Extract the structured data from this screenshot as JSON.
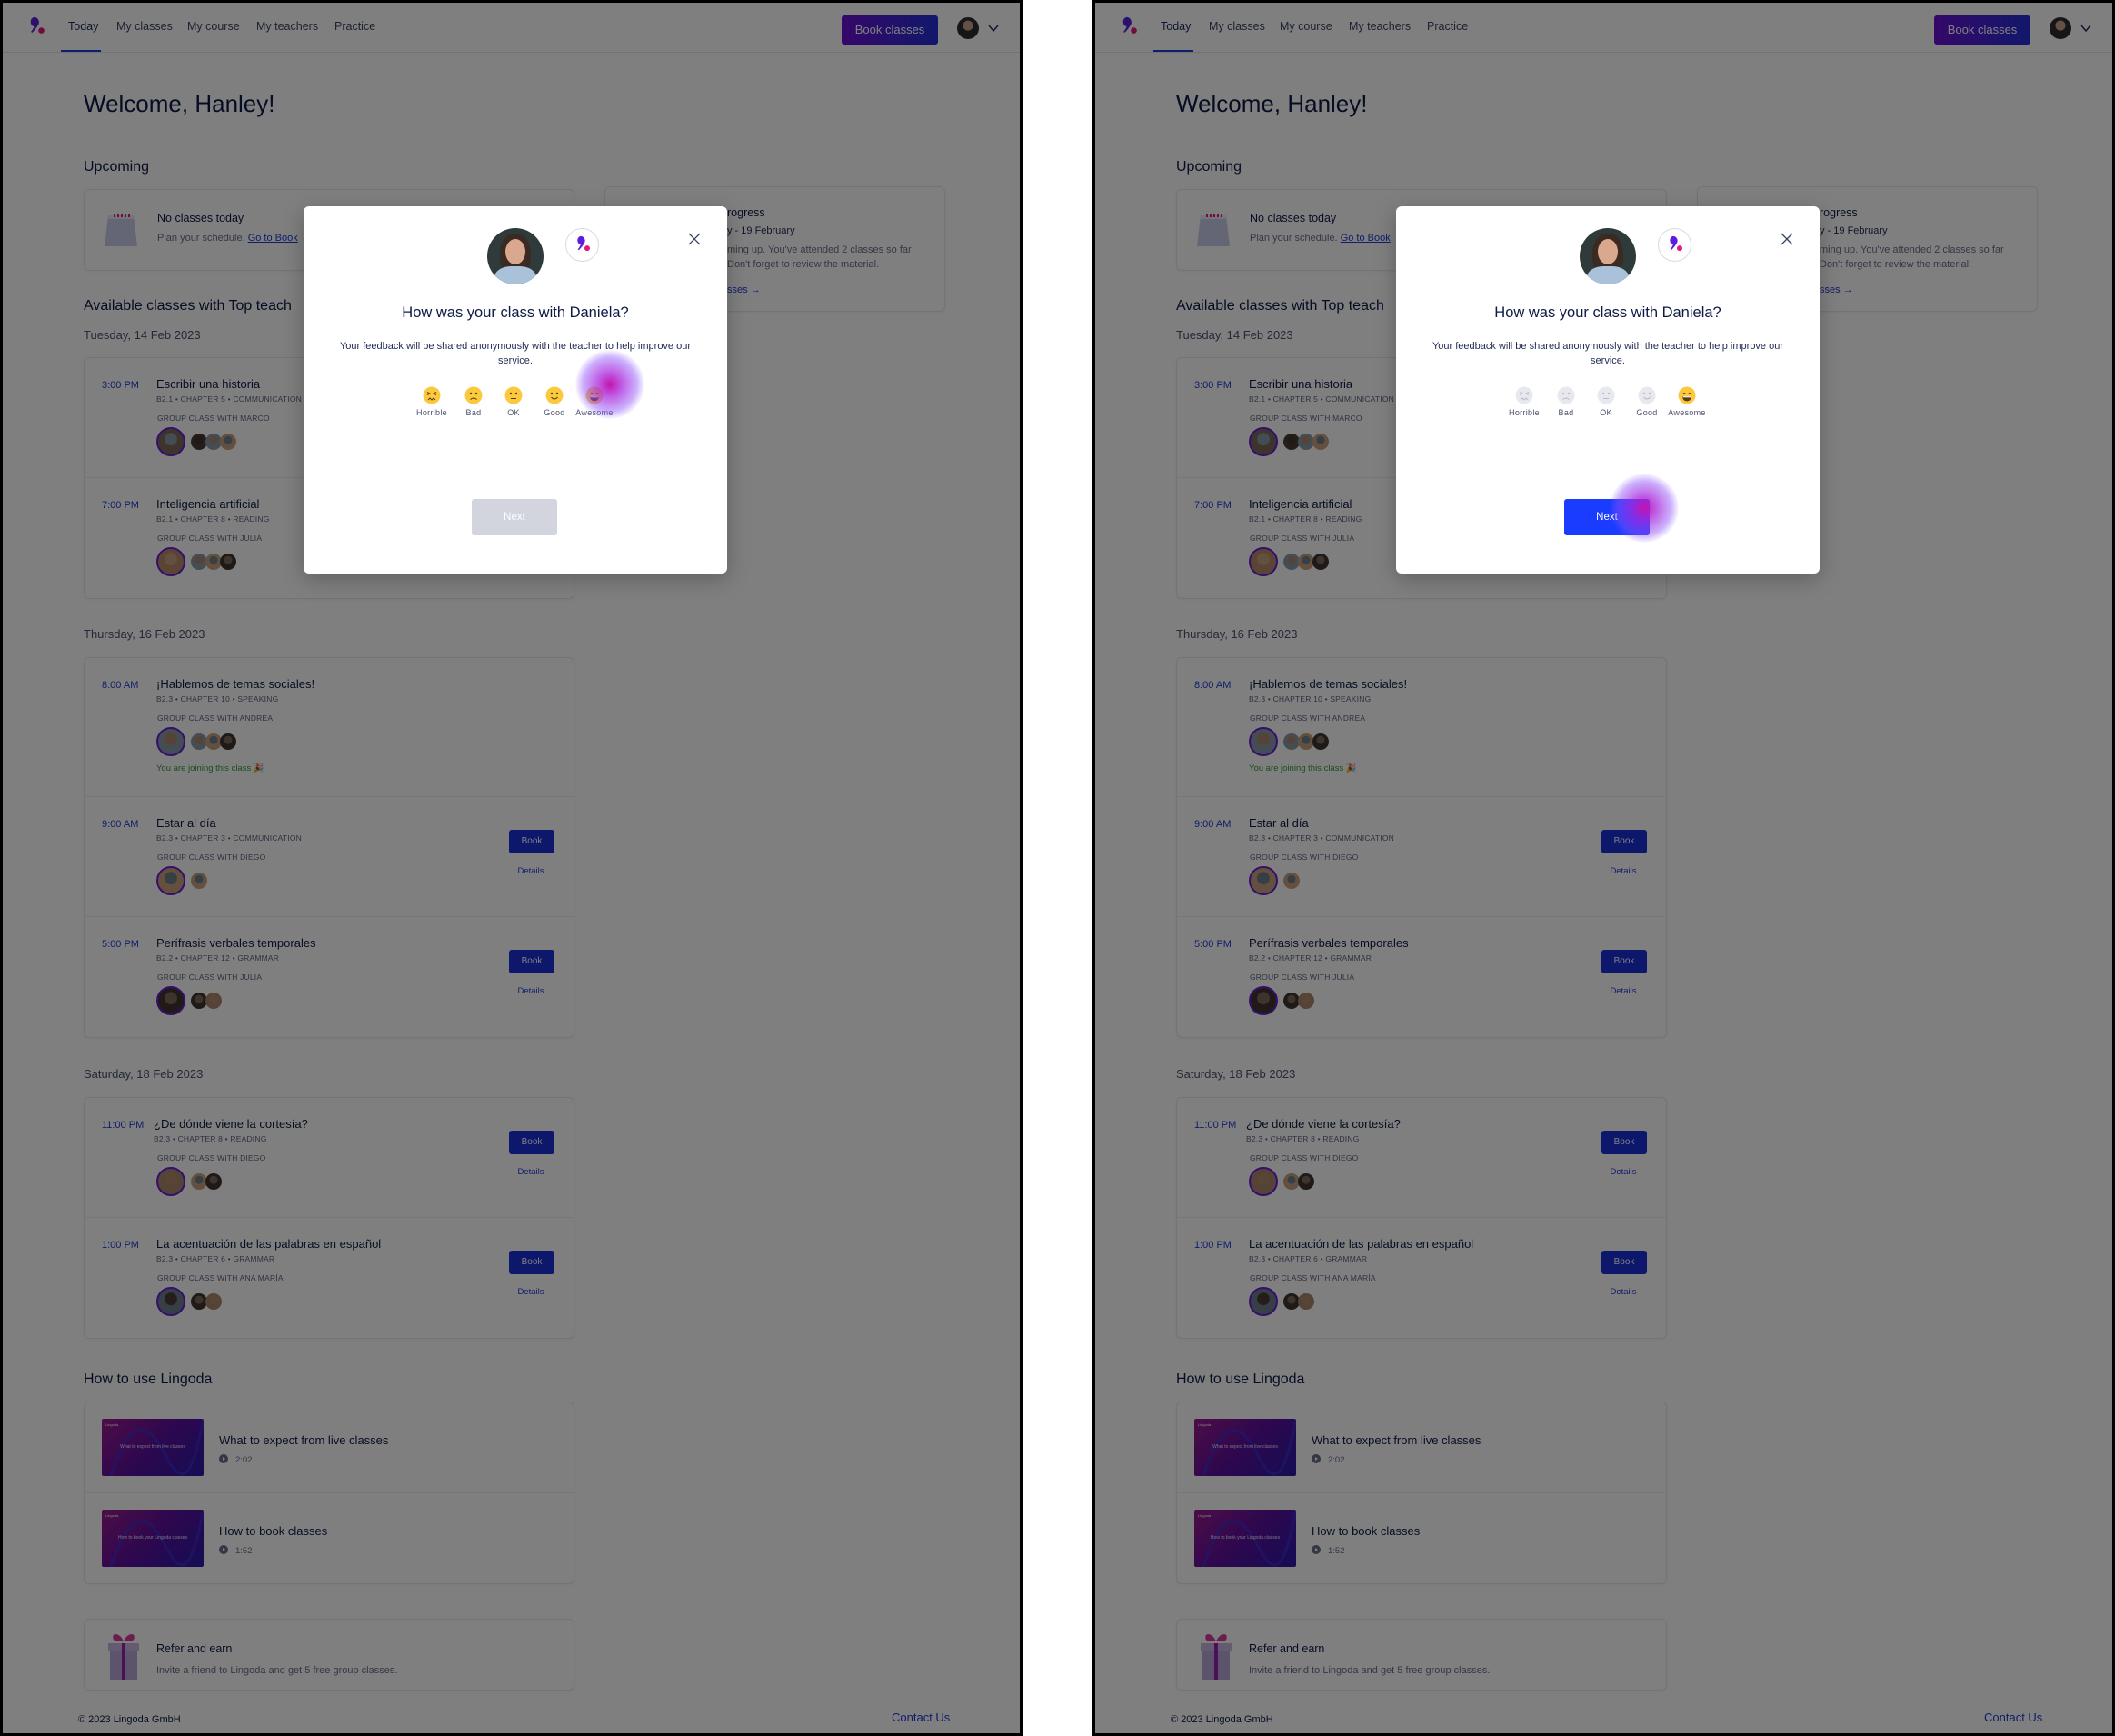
{
  "nav": {
    "items": [
      "Today",
      "My classes",
      "My course",
      "My teachers",
      "Practice"
    ],
    "active": "Today",
    "book_classes": "Book classes"
  },
  "welcome": "Welcome, Hanley!",
  "upcoming": {
    "title": "Upcoming",
    "no_classes": "No classes today",
    "plan_text": "Plan your schedule.",
    "plan_link": "Go to Book"
  },
  "progress": {
    "title_fragment": "rogress",
    "date_fragment": "y - 19 February",
    "line1_fragment": "ming up. You've attended 2 classes so far",
    "line2_fragment": "Don't forget to review the material.",
    "link_fragment": "sses"
  },
  "available": {
    "title": "Available classes with Top teach",
    "days": [
      {
        "date": "Tuesday, 14 Feb 2023",
        "classes": [
          {
            "time": "3:00 PM",
            "title": "Escribir una historia",
            "meta": "B2.1 • CHAPTER 5 • COMMUNICATION",
            "group": "GROUP CLASS WITH MARCO",
            "students": 3,
            "bookable": false,
            "joining": ""
          },
          {
            "time": "7:00 PM",
            "title": "Inteligencia artificial",
            "meta": "B2.1 • CHAPTER 8 • READING",
            "group": "GROUP CLASS WITH JULIA",
            "students": 3,
            "bookable": false,
            "joining": ""
          }
        ]
      },
      {
        "date": "Thursday, 16 Feb 2023",
        "classes": [
          {
            "time": "8:00 AM",
            "title": "¡Hablemos de temas sociales!",
            "meta": "B2.3 • CHAPTER 10 • SPEAKING",
            "group": "GROUP CLASS WITH ANDREA",
            "students": 3,
            "bookable": false,
            "joining": "You are joining this class 🎉"
          },
          {
            "time": "9:00 AM",
            "title": "Estar al día",
            "meta": "B2.3 • CHAPTER 3 • COMMUNICATION",
            "group": "GROUP CLASS WITH DIEGO",
            "students": 1,
            "bookable": true,
            "joining": ""
          },
          {
            "time": "5:00 PM",
            "title": "Perífrasis verbales temporales",
            "meta": "B2.2 • CHAPTER 12 • GRAMMAR",
            "group": "GROUP CLASS WITH JULIA",
            "students": 2,
            "bookable": true,
            "joining": ""
          }
        ]
      },
      {
        "date": "Saturday, 18 Feb 2023",
        "classes": [
          {
            "time": "11:00 PM",
            "title": "¿De dónde viene la cortesía?",
            "meta": "B2.3 • CHAPTER 8 • READING",
            "group": "GROUP CLASS WITH DIEGO",
            "students": 2,
            "bookable": true,
            "joining": ""
          },
          {
            "time": "1:00 PM",
            "title": "La acentuación de las palabras en español",
            "meta": "B2.3 • CHAPTER 6 • GRAMMAR",
            "group": "GROUP CLASS WITH ANA MARÍA",
            "students": 2,
            "bookable": true,
            "joining": ""
          }
        ]
      }
    ]
  },
  "book_label": "Book",
  "details_label": "Details",
  "how_to": {
    "title": "How to use Lingoda",
    "thumb_brand": "Lingoda",
    "videos": [
      {
        "title": "What to expect from live classes",
        "duration": "2:02",
        "thumb_text": "What to expect from live classes"
      },
      {
        "title": "How to book classes",
        "duration": "1:52",
        "thumb_text": "How to book your Lingoda classes"
      }
    ]
  },
  "refer": {
    "title": "Refer and earn",
    "text": "Invite a friend to Lingoda and get 5 free group classes."
  },
  "footer": {
    "copyright": "© 2023 Lingoda GmbH",
    "contact": "Contact Us"
  },
  "modal": {
    "title": "How was your class with Daniela?",
    "subtitle": "Your feedback will be shared anonymously with the teacher to help improve our service.",
    "ratings": [
      "Horrible",
      "Bad",
      "OK",
      "Good",
      "Awesome"
    ],
    "next": "Next"
  },
  "screens": [
    {
      "selected_rating": null,
      "next_enabled": false
    },
    {
      "selected_rating": "Awesome",
      "next_enabled": true
    }
  ],
  "colors": {
    "brand_blue": "#1a2fd9",
    "brand_purple": "#6b10d4",
    "accent_pink": "#e5177e",
    "next_active": "#1a3cff",
    "emoji_yellow": "#fbc93d",
    "joining_green": "#2f9b3d"
  }
}
